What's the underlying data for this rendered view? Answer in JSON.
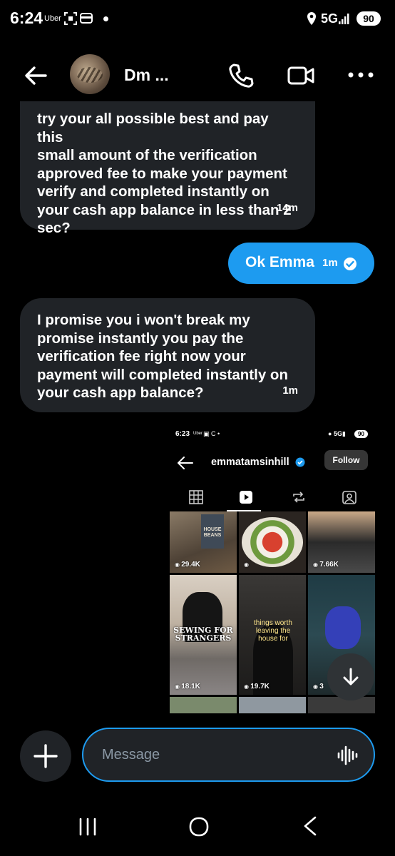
{
  "status_bar": {
    "time": "6:24",
    "carrier_app": "Uber",
    "network": "5G",
    "battery": "90"
  },
  "header": {
    "contact_name": "Dm ...",
    "icons": [
      "back-arrow-icon",
      "phone-icon",
      "video-camera-icon",
      "more-options-icon"
    ]
  },
  "messages": [
    {
      "direction": "incoming",
      "text": "try your all possible best and pay this\nsmall amount of the verification\napproved fee to make your payment\nverify and completed instantly on\nyour cash app balance in less than 2\nsec?",
      "time": "14m"
    },
    {
      "direction": "outgoing",
      "text": "Ok Emma",
      "time": "1m",
      "status": "read"
    },
    {
      "direction": "incoming",
      "text": "I promise you i won't break my\npromise instantly you pay the\nverification fee right now your\npayment will completed instantly on\nyour cash app balance?",
      "time": "1m"
    }
  ],
  "shared_screenshot": {
    "status_time": "6:23",
    "status_app": "Uber",
    "network": "5G",
    "battery": "90",
    "username": "emmatamsinhill",
    "follow_label": "Follow",
    "tabs": [
      "grid-icon",
      "reels-icon",
      "reposts-icon",
      "tagged-icon"
    ],
    "active_tab": "reels-icon",
    "tiles": [
      {
        "views": "29.4K",
        "caption": "HOUSE BEANS"
      },
      {
        "views": "",
        "caption": ""
      },
      {
        "views": "7.66K",
        "caption": ""
      },
      {
        "views": "18.1K",
        "caption": "SEWING FOR STRANGERS"
      },
      {
        "views": "19.7K",
        "caption": "things worth leaving the house for"
      },
      {
        "views": "3",
        "caption": ""
      }
    ]
  },
  "composer": {
    "placeholder": "Message"
  },
  "colors": {
    "accent": "#1d9bf0",
    "bubble_incoming": "#202327",
    "background": "#000000"
  }
}
